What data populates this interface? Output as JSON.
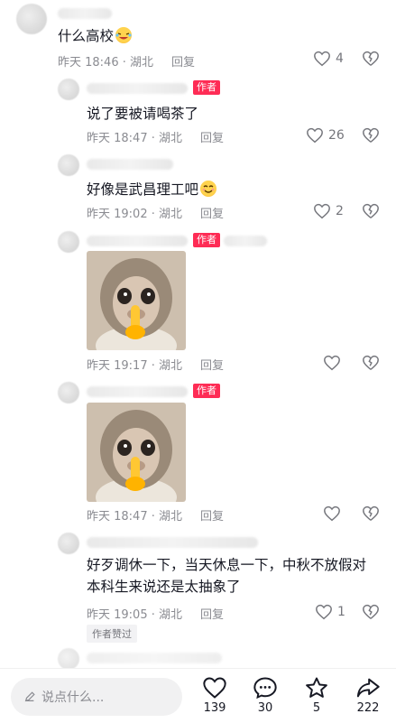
{
  "comments": [
    {
      "text": "什么高校",
      "time": "昨天 18:46 · 湖北",
      "reply": "回复",
      "likes": "4"
    },
    {
      "text": "说了要被请喝茶了",
      "time": "昨天 18:47 · 湖北",
      "reply": "回复",
      "likes": "26",
      "badge": "作者"
    },
    {
      "text": "好像是武昌理工吧",
      "time": "昨天 19:02 · 湖北",
      "reply": "回复",
      "likes": "2"
    },
    {
      "time": "昨天 19:17 · 湖北",
      "reply": "回复",
      "badge": "作者"
    },
    {
      "time": "昨天 18:47 · 湖北",
      "reply": "回复",
      "badge": "作者"
    },
    {
      "text_line1": "好歹调休一下，当天休息一下，中秋不放假对",
      "text_line2": "本科生来说还是太抽象了",
      "time": "昨天 19:05 · 湖北",
      "reply": "回复",
      "likes": "1",
      "liked_by_author": "作者赞过"
    }
  ],
  "bottom_bar": {
    "input_placeholder": "说点什么...",
    "likes_count": "139",
    "comments_count": "30",
    "favorites_count": "5",
    "shares_count": "222"
  },
  "colors": {
    "accent": "#fe2c55",
    "meta": "#8a8b91"
  }
}
